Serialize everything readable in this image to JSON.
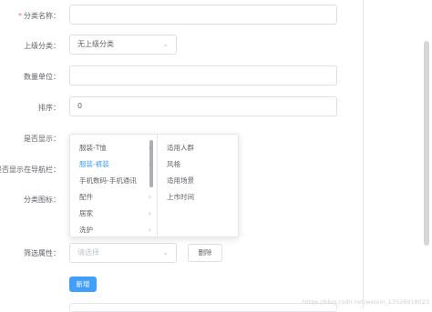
{
  "form": {
    "category_name": {
      "label": "分类名称：",
      "required_mark": "*",
      "value": ""
    },
    "parent_category": {
      "label": "上级分类：",
      "value": "无上级分类"
    },
    "unit": {
      "label": "数量单位：",
      "value": ""
    },
    "sort": {
      "label": "排序：",
      "value": "0"
    },
    "show": {
      "label": "是否显示："
    },
    "show_in_nav": {
      "label": "是否显示在导航栏："
    },
    "icon": {
      "label": "分类图标："
    },
    "filter": {
      "label": "筛选属性：",
      "placeholder": "请选择",
      "delete_label": "删除"
    },
    "add_label": "新增"
  },
  "cascader": {
    "level1": [
      {
        "label": "服装-T恤",
        "active": false
      },
      {
        "label": "服装-裤装",
        "active": true
      },
      {
        "label": "手机数码-手机通讯",
        "active": false
      },
      {
        "label": "配件",
        "active": false
      },
      {
        "label": "居家",
        "active": false
      },
      {
        "label": "洗护",
        "active": false
      }
    ],
    "level2": [
      {
        "label": "适用人群"
      },
      {
        "label": "风格"
      },
      {
        "label": "适用场景"
      },
      {
        "label": "上市时间"
      }
    ]
  },
  "icons": {
    "chevron": "chevron-down-icon",
    "arrow": "chevron-right-icon"
  },
  "colors": {
    "primary": "#409eff",
    "required": "#f56c6c",
    "border": "#dcdfe6"
  },
  "watermark": "https://blog.csdn.net/weixin_13526918023"
}
